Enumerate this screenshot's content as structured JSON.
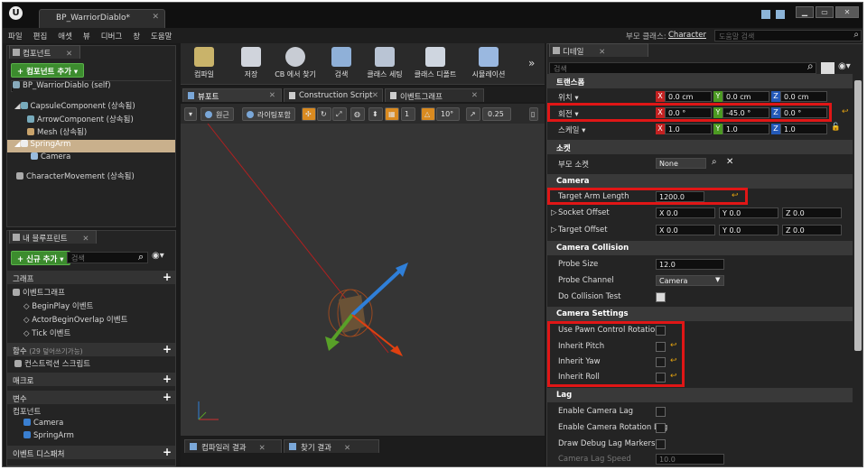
{
  "window": {
    "tab_title": "BP_WarriorDiablo*",
    "logo": "U",
    "buttons": [
      "▁",
      "▭",
      "✕"
    ]
  },
  "menubar": {
    "items": [
      "파일",
      "편집",
      "애셋",
      "뷰",
      "디버그",
      "창",
      "도움말"
    ],
    "parent_class_label": "부모 클래스:",
    "parent_class_value": "Character",
    "help_search_placeholder": "도움말 검색"
  },
  "components": {
    "tab_label": "컴포넌트",
    "add_button": "+ 컴포넌트 추가 ▾",
    "search_placeholder": "검색",
    "tree": [
      {
        "label": "BP_WarriorDiablo (self)",
        "indent": 0
      },
      {
        "label": "CapsuleComponent (상속됨)",
        "indent": 1
      },
      {
        "label": "ArrowComponent (상속됨)",
        "indent": 2
      },
      {
        "label": "Mesh (상속됨)",
        "indent": 2
      },
      {
        "label": "SpringArm",
        "indent": 1,
        "selected": true
      },
      {
        "label": "Camera",
        "indent": 2
      },
      {
        "label": "CharacterMovement (상속됨)",
        "indent": 0
      }
    ]
  },
  "blueprint": {
    "tab_label": "내 블루프린트",
    "add_button": "+ 신규 추가 ▾",
    "search_placeholder": "검색",
    "graph_header": "그래프",
    "event_graph": "이벤트그래프",
    "events": [
      "BeginPlay 이벤트",
      "ActorBeginOverlap 이벤트",
      "Tick 이벤트"
    ],
    "functions_header": "함수",
    "functions_hidden": "(29 덮어쓰기가능)",
    "construction_script": "컨스트럭션 스크립트",
    "macros_header": "매크로",
    "variables_header": "변수",
    "components_group": "컴포넌트",
    "variables": [
      "Camera",
      "SpringArm"
    ],
    "dispatchers_header": "이벤트 디스패처"
  },
  "toolbar": {
    "items": [
      "컴파일",
      "저장",
      "CB 에서 찾기",
      "검색",
      "클래스 세팅",
      "클래스 디폴트",
      "시뮬레이션"
    ]
  },
  "viewport_tabs": [
    "뷰포트",
    "Construction Script",
    "이벤트그래프"
  ],
  "viewport_bar": {
    "perspective": "원근",
    "lighting": "라이팅포함",
    "snap_angle": "10°",
    "scale": "0.25"
  },
  "bottom_tabs": [
    "컴파일러 결과",
    "찾기 결과"
  ],
  "details": {
    "tab_label": "디테일",
    "search_placeholder": "검색",
    "transform_header": "트랜스폼",
    "location_label": "위치 ▾",
    "location": [
      "0.0 cm",
      "0.0 cm",
      "0.0 cm"
    ],
    "rotation_label": "회전 ▾",
    "rotation": [
      "0.0 °",
      "-45.0 °",
      "0.0 °"
    ],
    "scale_label": "스케일 ▾",
    "scale": [
      "1.0",
      "1.0",
      "1.0"
    ],
    "socket_header": "소켓",
    "parent_socket_label": "부모 소켓",
    "parent_socket_value": "None",
    "camera_header": "Camera",
    "target_arm_length_label": "Target Arm Length",
    "target_arm_length": "1200.0",
    "socket_offset_label": "Socket Offset",
    "socket_offset": [
      "0.0",
      "0.0",
      "0.0"
    ],
    "target_offset_label": "Target Offset",
    "target_offset": [
      "0.0",
      "0.0",
      "0.0"
    ],
    "camera_collision_header": "Camera Collision",
    "probe_size_label": "Probe Size",
    "probe_size": "12.0",
    "probe_channel_label": "Probe Channel",
    "probe_channel": "Camera",
    "do_collision_test_label": "Do Collision Test",
    "camera_settings_header": "Camera Settings",
    "use_pawn_control_rotation": "Use Pawn Control Rotation",
    "inherit_pitch": "Inherit Pitch",
    "inherit_yaw": "Inherit Yaw",
    "inherit_roll": "Inherit Roll",
    "lag_header": "Lag",
    "enable_camera_lag": "Enable Camera Lag",
    "enable_camera_rotation_lag": "Enable Camera Rotation Lag",
    "draw_debug_lag_markers": "Draw Debug Lag Markers",
    "camera_lag_speed_label": "Camera Lag Speed",
    "camera_lag_speed": "10.0"
  },
  "colors": {
    "highlight_red": "#e01616",
    "selection": "#c9b08c",
    "add_green": "#3c8c2e"
  }
}
